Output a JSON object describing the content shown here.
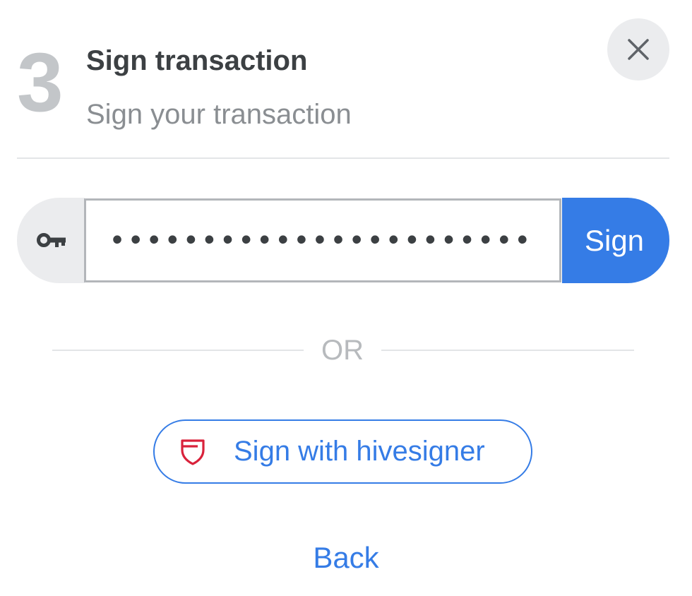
{
  "step": {
    "number": "3",
    "title": "Sign transaction",
    "subtitle": "Sign your transaction"
  },
  "close_button": {
    "icon": "close-icon"
  },
  "key_field": {
    "prefix_icon": "key-icon",
    "value": "••••••••••••••••••••••••••••••••••••••••••••••••••••••",
    "masked": "••••••••••••••••••••••••••••••••"
  },
  "actions": {
    "sign_label": "Sign",
    "divider_label": "OR",
    "hivesigner_label": "Sign with hivesigner",
    "hivesigner_icon": "hivesigner-shield-icon",
    "back_label": "Back"
  },
  "colors": {
    "accent": "#357ce6",
    "hivesigner_red": "#d9223b",
    "muted": "#c3c6c9"
  }
}
